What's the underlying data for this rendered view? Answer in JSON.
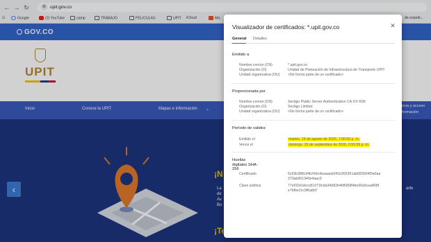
{
  "browser": {
    "url": "upit.gov.co",
    "bookmarks": [
      "Google",
      "(2) YouTube",
      "camp",
      "TRABAJO",
      "PELICULAS",
      "UPIT",
      "iCloud",
      "Mic",
      "de expedi..."
    ]
  },
  "site": {
    "gov_logo": "GOV.CO",
    "upit_logo": "UPIT",
    "nav": [
      "Inicio",
      "Conoce la UPIT",
      "Mapas e información"
    ],
    "nav_right": [
      "ncia y acceso",
      "formación"
    ],
    "hero_title_1": "¡N",
    "hero_title_2": "¡Te",
    "hero_lines": [
      "La",
      "de",
      "Av",
      "Bo"
    ],
    "hero_right": "arte"
  },
  "dialog": {
    "title": "Visualizador de certificados: *.upit.gov.co",
    "tabs": [
      "General",
      "Detalles"
    ],
    "issued_to": {
      "title": "Emitido a",
      "rows": [
        {
          "label": "Nombre común (CN)",
          "value": "*.upit.gov.co"
        },
        {
          "label": "Organización (O)",
          "value": "Unidad de Planeación de Infraestructura de Transporte UPIT"
        },
        {
          "label": "Unidad organizativa (OU)",
          "value": "<No forma parte de un certificado>"
        }
      ]
    },
    "issued_by": {
      "title": "Proporcionada por",
      "rows": [
        {
          "label": "Nombre común (CN)",
          "value": "Sectigo Public Server Authentication CA OV R36"
        },
        {
          "label": "Organización (O)",
          "value": "Sectigo Limited"
        },
        {
          "label": "Unidad organizativa (OU)",
          "value": "<No forma parte de un certificado>"
        }
      ]
    },
    "validity": {
      "title": "Período de validez",
      "rows": [
        {
          "label": "Emitido el",
          "value": "martes, 19 de agosto de 2025, 7:00:00 p. m."
        },
        {
          "label": "Vence el",
          "value": "domingo, 20 de septiembre de 2026, 6:59:59 p. m."
        }
      ]
    },
    "fingerprints": {
      "title": "Huellas digitales SHA-256",
      "rows": [
        {
          "label": "Certificado",
          "value": "5c63b388c94b24dc4eaaaeb341b355351ab6830045fa0aa373ab961940e4aac9"
        },
        {
          "label": "Clave pública",
          "value": "77ef32d1dccc81971fcda34d82b4bf58984be90a5cea868fe7bfbe2cc9f6a8d7"
        }
      ]
    }
  },
  "colors": {
    "gov_blue": "#3366cc",
    "site_dark": "#1e3580",
    "highlight": "#fff200",
    "upit_gold": "#b8862b"
  }
}
